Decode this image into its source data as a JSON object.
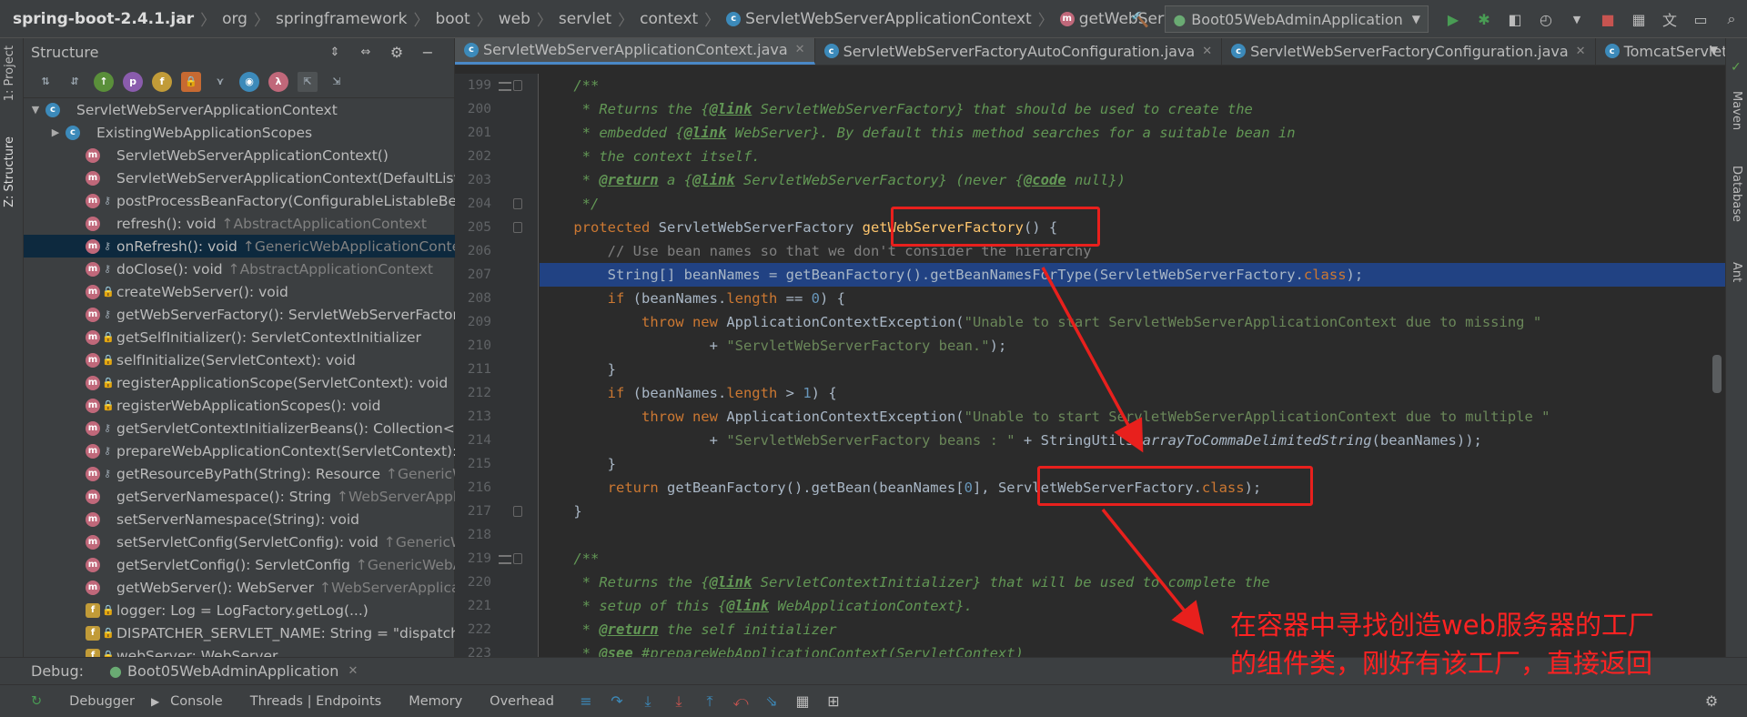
{
  "breadcrumbs": [
    "spring-boot-2.4.1.jar",
    "org",
    "springframework",
    "boot",
    "web",
    "servlet",
    "context",
    "ServletWebServerApplicationContext",
    "getWebServerFactory"
  ],
  "run_config": "Boot05WebAdminApplication",
  "left_tool_tabs": [
    "1: Project",
    "Z: Structure"
  ],
  "right_tool_tabs": [
    "Maven",
    "Database",
    "Ant"
  ],
  "structure": {
    "title": "Structure",
    "rows": [
      {
        "text": "ServletWebServerApplicationContext",
        "icon": "c",
        "vis": "",
        "inherit": "",
        "indent": 0,
        "arrow": "▼",
        "selected": false
      },
      {
        "text": "ExistingWebApplicationScopes",
        "icon": "c",
        "vis": "",
        "inherit": "",
        "indent": 1,
        "arrow": "▶",
        "selected": false
      },
      {
        "text": "ServletWebServerApplicationContext()",
        "icon": "m",
        "vis": "",
        "inherit": "",
        "indent": 2,
        "arrow": "",
        "selected": false
      },
      {
        "text": "ServletWebServerApplicationContext(DefaultListableBeanFactory)",
        "icon": "m",
        "vis": "",
        "inherit": "",
        "indent": 2,
        "arrow": "",
        "selected": false
      },
      {
        "text": "postProcessBeanFactory(ConfigurableListableBeanFactory): void",
        "icon": "m",
        "vis": "protected",
        "inherit": "",
        "indent": 2,
        "arrow": "",
        "selected": false
      },
      {
        "text": "refresh(): void",
        "icon": "m",
        "vis": "",
        "inherit": "↑AbstractApplicationContext",
        "indent": 2,
        "arrow": "",
        "selected": false
      },
      {
        "text": "onRefresh(): void",
        "icon": "m",
        "vis": "protected",
        "inherit": "↑GenericWebApplicationContext",
        "indent": 2,
        "arrow": "",
        "selected": true
      },
      {
        "text": "doClose(): void",
        "icon": "m",
        "vis": "protected",
        "inherit": "↑AbstractApplicationContext",
        "indent": 2,
        "arrow": "",
        "selected": false
      },
      {
        "text": "createWebServer(): void",
        "icon": "m",
        "vis": "private",
        "inherit": "",
        "indent": 2,
        "arrow": "",
        "selected": false
      },
      {
        "text": "getWebServerFactory(): ServletWebServerFactory",
        "icon": "m",
        "vis": "protected",
        "inherit": "",
        "indent": 2,
        "arrow": "",
        "selected": false
      },
      {
        "text": "getSelfInitializer(): ServletContextInitializer",
        "icon": "m",
        "vis": "private",
        "inherit": "",
        "indent": 2,
        "arrow": "",
        "selected": false
      },
      {
        "text": "selfInitialize(ServletContext): void",
        "icon": "m",
        "vis": "private",
        "inherit": "",
        "indent": 2,
        "arrow": "",
        "selected": false
      },
      {
        "text": "registerApplicationScope(ServletContext): void",
        "icon": "m",
        "vis": "private",
        "inherit": "",
        "indent": 2,
        "arrow": "",
        "selected": false
      },
      {
        "text": "registerWebApplicationScopes(): void",
        "icon": "m",
        "vis": "private",
        "inherit": "",
        "indent": 2,
        "arrow": "",
        "selected": false
      },
      {
        "text": "getServletContextInitializerBeans(): Collection<ServletContextInitializer>",
        "icon": "m",
        "vis": "protected",
        "inherit": "",
        "indent": 2,
        "arrow": "",
        "selected": false
      },
      {
        "text": "prepareWebApplicationContext(ServletContext): void",
        "icon": "m",
        "vis": "protected",
        "inherit": "",
        "indent": 2,
        "arrow": "",
        "selected": false
      },
      {
        "text": "getResourceByPath(String): Resource",
        "icon": "m",
        "vis": "protected",
        "inherit": "↑GenericWebApplicationContext",
        "indent": 2,
        "arrow": "",
        "selected": false
      },
      {
        "text": "getServerNamespace(): String",
        "icon": "m",
        "vis": "",
        "inherit": "↑WebServerApplicationContext",
        "indent": 2,
        "arrow": "",
        "selected": false
      },
      {
        "text": "setServerNamespace(String): void",
        "icon": "m",
        "vis": "",
        "inherit": "",
        "indent": 2,
        "arrow": "",
        "selected": false
      },
      {
        "text": "setServletConfig(ServletConfig): void",
        "icon": "m",
        "vis": "",
        "inherit": "↑GenericWebApplicationContext",
        "indent": 2,
        "arrow": "",
        "selected": false
      },
      {
        "text": "getServletConfig(): ServletConfig",
        "icon": "m",
        "vis": "",
        "inherit": "↑GenericWebApplicationContext",
        "indent": 2,
        "arrow": "",
        "selected": false
      },
      {
        "text": "getWebServer(): WebServer",
        "icon": "m",
        "vis": "",
        "inherit": "↑WebServerApplicationContext",
        "indent": 2,
        "arrow": "",
        "selected": false
      },
      {
        "text": "logger: Log = LogFactory.getLog(...)",
        "icon": "f",
        "vis": "static",
        "inherit": "",
        "indent": 2,
        "arrow": "",
        "selected": false
      },
      {
        "text": "DISPATCHER_SERVLET_NAME: String = \"dispatcherServlet\"",
        "icon": "f",
        "vis": "static",
        "inherit": "",
        "indent": 2,
        "arrow": "",
        "selected": false
      },
      {
        "text": "webServer: WebServer",
        "icon": "f",
        "vis": "private",
        "inherit": "",
        "indent": 2,
        "arrow": "",
        "selected": false
      }
    ]
  },
  "editor_tabs": [
    {
      "label": "ServletWebServerApplicationContext.java",
      "active": true
    },
    {
      "label": "ServletWebServerFactoryAutoConfiguration.java",
      "active": false
    },
    {
      "label": "ServletWebServerFactoryConfiguration.java",
      "active": false
    },
    {
      "label": "TomcatServletWebServerFactory.java",
      "active": false
    }
  ],
  "code_lines": [
    {
      "n": "199",
      "segs": [
        [
          "    ",
          ""
        ],
        [
          "/**",
          "jd"
        ]
      ]
    },
    {
      "n": "200",
      "segs": [
        [
          "     * Returns the {",
          "jd"
        ],
        [
          "@link",
          "jdtag"
        ],
        [
          " ServletWebServerFactory} that should be used to create the",
          "jd"
        ]
      ]
    },
    {
      "n": "201",
      "segs": [
        [
          "     * embedded {",
          "jd"
        ],
        [
          "@link",
          "jdtag"
        ],
        [
          " WebServer}. By default this method searches for a suitable bean in",
          "jd"
        ]
      ]
    },
    {
      "n": "202",
      "segs": [
        [
          "     * the context itself.",
          "jd"
        ]
      ]
    },
    {
      "n": "203",
      "segs": [
        [
          "     * ",
          "jd"
        ],
        [
          "@return",
          "jdtag"
        ],
        [
          " a {",
          "jd"
        ],
        [
          "@link",
          "jdtag"
        ],
        [
          " ServletWebServerFactory} (never {",
          "jd"
        ],
        [
          "@code",
          "jdtag"
        ],
        [
          " null})",
          "jd"
        ]
      ]
    },
    {
      "n": "204",
      "segs": [
        [
          "     */",
          "jd"
        ]
      ]
    },
    {
      "n": "205",
      "segs": [
        [
          "    ",
          ""
        ],
        [
          "protected",
          "kw"
        ],
        [
          " ServletWebServerFactory ",
          ""
        ],
        [
          "getWebServerFactory",
          "fn"
        ],
        [
          "() {",
          ""
        ]
      ]
    },
    {
      "n": "206",
      "segs": [
        [
          "        ",
          ""
        ],
        [
          "// Use bean names so that we don't consider the hierarchy",
          "cm"
        ]
      ]
    },
    {
      "n": "207",
      "segs": [
        [
          "        String[] beanNames = getBeanFactory().getBeanNamesForType(ServletWebServerFactory.",
          ""
        ],
        [
          "class",
          "kw"
        ],
        [
          ");",
          ""
        ]
      ],
      "hl": true
    },
    {
      "n": "208",
      "segs": [
        [
          "        ",
          ""
        ],
        [
          "if",
          "kw"
        ],
        [
          " (beanNames.",
          ""
        ],
        [
          "length",
          "kw"
        ],
        [
          " == ",
          ""
        ],
        [
          "0",
          "num"
        ],
        [
          ") {",
          ""
        ]
      ]
    },
    {
      "n": "209",
      "segs": [
        [
          "            ",
          ""
        ],
        [
          "throw new",
          "kw"
        ],
        [
          " ApplicationContextException(",
          ""
        ],
        [
          "\"Unable to start ServletWebServerApplicationContext due to missing \"",
          "str"
        ]
      ]
    },
    {
      "n": "210",
      "segs": [
        [
          "                    + ",
          ""
        ],
        [
          "\"ServletWebServerFactory bean.\"",
          "str"
        ],
        [
          ");",
          ""
        ]
      ]
    },
    {
      "n": "211",
      "segs": [
        [
          "        }",
          ""
        ]
      ]
    },
    {
      "n": "212",
      "segs": [
        [
          "        ",
          ""
        ],
        [
          "if",
          "kw"
        ],
        [
          " (beanNames.",
          ""
        ],
        [
          "length",
          "kw"
        ],
        [
          " > ",
          ""
        ],
        [
          "1",
          "num"
        ],
        [
          ") {",
          ""
        ]
      ]
    },
    {
      "n": "213",
      "segs": [
        [
          "            ",
          ""
        ],
        [
          "throw new",
          "kw"
        ],
        [
          " ApplicationContextException(",
          ""
        ],
        [
          "\"Unable to start ServletWebServerApplicationContext due to multiple \"",
          "str"
        ]
      ]
    },
    {
      "n": "214",
      "segs": [
        [
          "                    + ",
          ""
        ],
        [
          "\"ServletWebServerFactory beans : \"",
          "str"
        ],
        [
          " + StringUtils.",
          ""
        ],
        [
          "arrayToCommaDelimitedString",
          "st"
        ],
        [
          "(beanNames));",
          ""
        ]
      ]
    },
    {
      "n": "215",
      "segs": [
        [
          "        }",
          ""
        ]
      ]
    },
    {
      "n": "216",
      "segs": [
        [
          "        ",
          ""
        ],
        [
          "return",
          "kw"
        ],
        [
          " getBeanFactory().getBean(beanNames[",
          ""
        ],
        [
          "0",
          "num"
        ],
        [
          "], ServletWebServerFactory.",
          ""
        ],
        [
          "class",
          "kw"
        ],
        [
          ");",
          ""
        ]
      ]
    },
    {
      "n": "217",
      "segs": [
        [
          "    }",
          ""
        ]
      ]
    },
    {
      "n": "218",
      "segs": []
    },
    {
      "n": "219",
      "segs": [
        [
          "    ",
          ""
        ],
        [
          "/**",
          "jd"
        ]
      ]
    },
    {
      "n": "220",
      "segs": [
        [
          "     * Returns the {",
          "jd"
        ],
        [
          "@link",
          "jdtag"
        ],
        [
          " ServletContextInitializer} that will be used to complete the",
          "jd"
        ]
      ]
    },
    {
      "n": "221",
      "segs": [
        [
          "     * setup of this {",
          "jd"
        ],
        [
          "@link",
          "jdtag"
        ],
        [
          " WebApplicationContext}.",
          "jd"
        ]
      ]
    },
    {
      "n": "222",
      "segs": [
        [
          "     * ",
          "jd"
        ],
        [
          "@return",
          "jdtag"
        ],
        [
          " the self initializer",
          "jd"
        ]
      ]
    },
    {
      "n": "223",
      "segs": [
        [
          "     * ",
          "jd"
        ],
        [
          "@see",
          "jdtag"
        ],
        [
          " #prepareWebApplicationContext(ServletContext)",
          "jd"
        ]
      ]
    }
  ],
  "debug": {
    "label": "Debug:",
    "config": "Boot05WebAdminApplication",
    "tabs": [
      "Debugger",
      "Console",
      "Threads | Endpoints",
      "Memory",
      "Overhead"
    ]
  },
  "annotation": {
    "line1": "在容器中寻找创造web服务器的工厂",
    "line2": "的组件类，刚好有该工厂，直接返回",
    "color": "#ff2222"
  }
}
